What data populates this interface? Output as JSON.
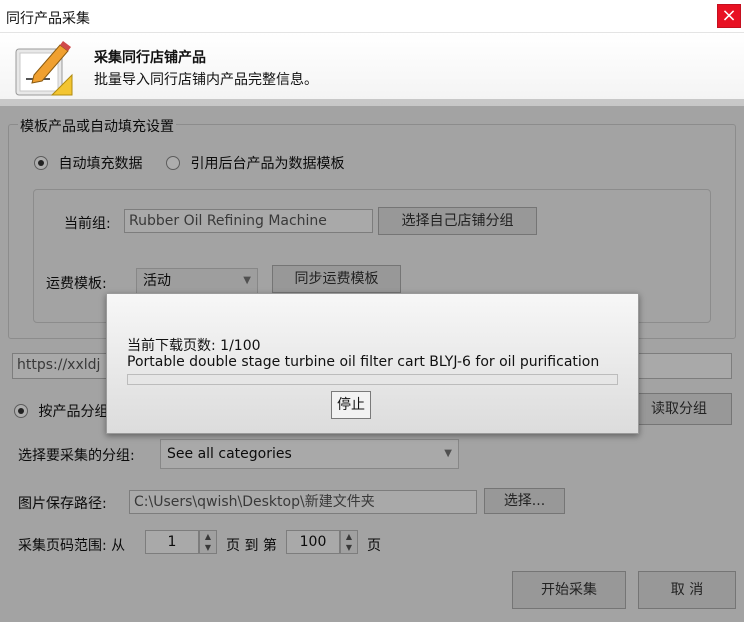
{
  "window": {
    "title": "同行产品采集",
    "close_label": "×"
  },
  "header": {
    "title": "采集同行店铺产品",
    "subtitle": "批量导入同行店铺内产品完整信息。"
  },
  "template_settings": {
    "legend": "模板产品或自动填充设置",
    "radio_auto_fill": "自动填充数据",
    "radio_use_backend": "引用后台产品为数据模板",
    "current_group_label": "当前组:",
    "current_group_value": "Rubber Oil Refining Machine",
    "select_group_button": "选择自己店铺分组",
    "shipping_template_label": "运费模板:",
    "shipping_template_value": "活动",
    "sync_shipping_button": "同步运费模板"
  },
  "url_input": {
    "value": "https://xxldj"
  },
  "group_collect": {
    "radio_by_group": "按产品分组",
    "read_group_button": "读取分组",
    "select_group_label": "选择要采集的分组:",
    "select_group_value": "See all categories"
  },
  "save_path": {
    "label": "图片保存路径:",
    "value": "C:\\Users\\qwish\\Desktop\\新建文件夹",
    "browse_button": "选择..."
  },
  "page_range": {
    "label": "采集页码范围: 从",
    "from_value": "1",
    "to_label": "页 到 第",
    "to_value": "100",
    "suffix": "页"
  },
  "footer": {
    "start_button": "开始采集",
    "cancel_button": "取 消"
  },
  "progress_dialog": {
    "page_status": "当前下载页数: 1/100",
    "current_item": "Portable double stage turbine oil filter cart BLYJ-6 for oil purification",
    "progress_fraction": 0.0,
    "stop_button": "停止"
  }
}
